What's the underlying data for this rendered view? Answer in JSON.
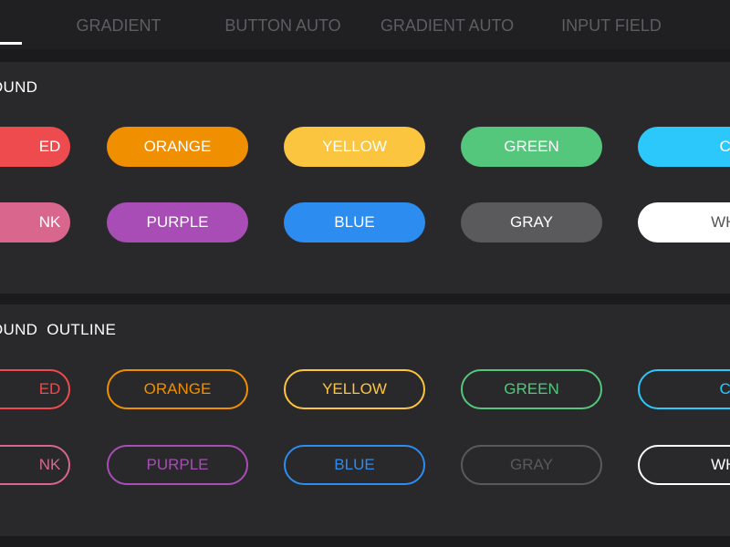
{
  "tabs": [
    {
      "label": "GRADIENT"
    },
    {
      "label": "BUTTON AUTO"
    },
    {
      "label": "GRADIENT AUTO"
    },
    {
      "label": "INPUT FIELD"
    }
  ],
  "colors": {
    "background": "#1b1b1d",
    "panel": "#29292b",
    "tab_inactive_text": "#5e5e62",
    "red": "#ee4b4e",
    "orange": "#f08f00",
    "yellow": "#fbc540",
    "green": "#54c77d",
    "cyan": "#2dc8fb",
    "pink": "#d9668d",
    "purple": "#a84db5",
    "blue": "#2d8cf0",
    "gray": "#5a5a5c",
    "white": "#ffffff"
  },
  "sections": [
    {
      "title": "OUND",
      "rows": [
        [
          {
            "label": "ED",
            "color": "#ee4b4e"
          },
          {
            "label": "ORANGE",
            "color": "#f08f00"
          },
          {
            "label": "YELLOW",
            "color": "#fbc540"
          },
          {
            "label": "GREEN",
            "color": "#54c77d"
          },
          {
            "label": "CYAN",
            "color": "#2dc8fb"
          }
        ],
        [
          {
            "label": "NK",
            "color": "#d9668d"
          },
          {
            "label": "PURPLE",
            "color": "#a84db5"
          },
          {
            "label": "BLUE",
            "color": "#2d8cf0"
          },
          {
            "label": "GRAY",
            "color": "#5a5a5c"
          },
          {
            "label": "WHITE",
            "color": "#ffffff"
          }
        ]
      ]
    },
    {
      "title": "OUND  OUTLINE",
      "rows": [
        [
          {
            "label": "ED",
            "color": "#ee4b4e"
          },
          {
            "label": "ORANGE",
            "color": "#f08f00"
          },
          {
            "label": "YELLOW",
            "color": "#fbc540"
          },
          {
            "label": "GREEN",
            "color": "#54c77d"
          },
          {
            "label": "CYAN",
            "color": "#2dc8fb"
          }
        ],
        [
          {
            "label": "NK",
            "color": "#d9668d"
          },
          {
            "label": "PURPLE",
            "color": "#a84db5"
          },
          {
            "label": "BLUE",
            "color": "#2d8cf0"
          },
          {
            "label": "GRAY",
            "color": "#5a5a5c"
          },
          {
            "label": "WHITE",
            "color": "#ffffff"
          }
        ]
      ]
    }
  ]
}
